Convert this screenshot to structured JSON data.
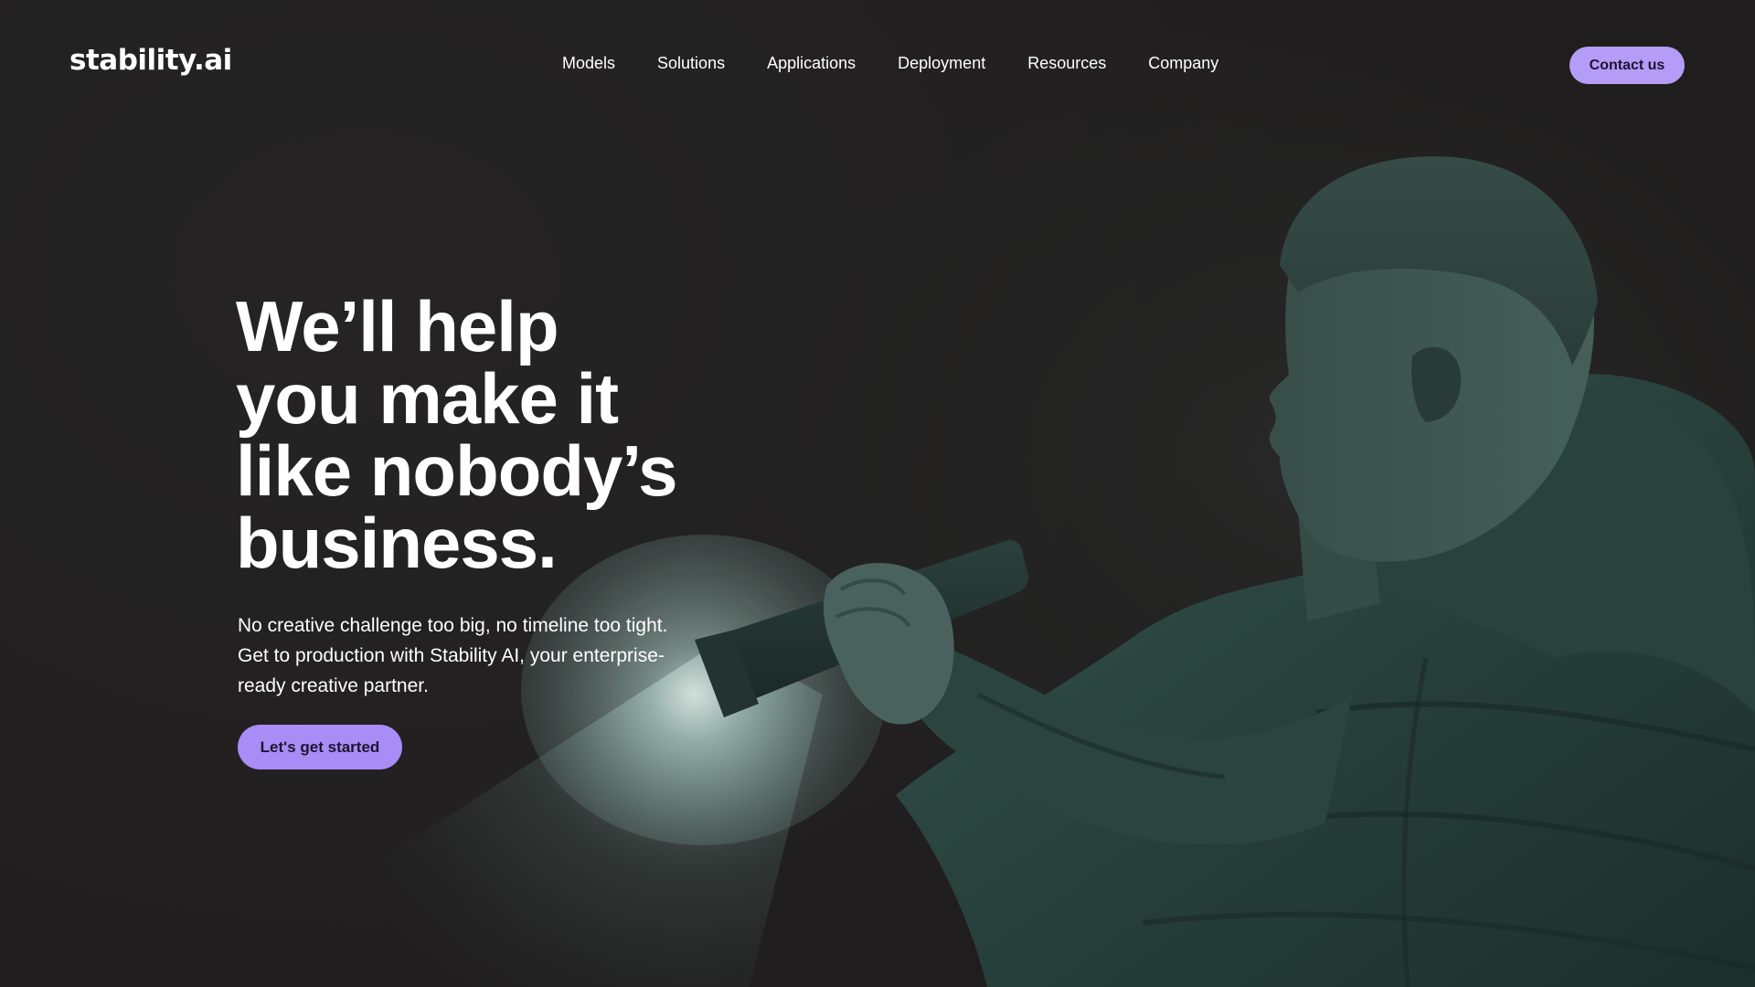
{
  "header": {
    "logo_text": "stability.ai",
    "nav_items": [
      "Models",
      "Solutions",
      "Applications",
      "Deployment",
      "Resources",
      "Company"
    ],
    "contact_label": "Contact us"
  },
  "hero": {
    "headline_lines": [
      "We’ll help",
      "you make it",
      "like nobody’s",
      "business."
    ],
    "subtext_lines": [
      "No creative challenge too big, no timeline too tight.",
      "Get to production with Stability AI, your enterprise-",
      "ready creative partner."
    ],
    "cta_label": "Let's get started",
    "image_icon": "person-with-flashlight-illustration"
  },
  "colors": {
    "background": "#252323",
    "accent": "#b49cf7",
    "jacket": "#2f4a45",
    "text": "#ffffff"
  }
}
